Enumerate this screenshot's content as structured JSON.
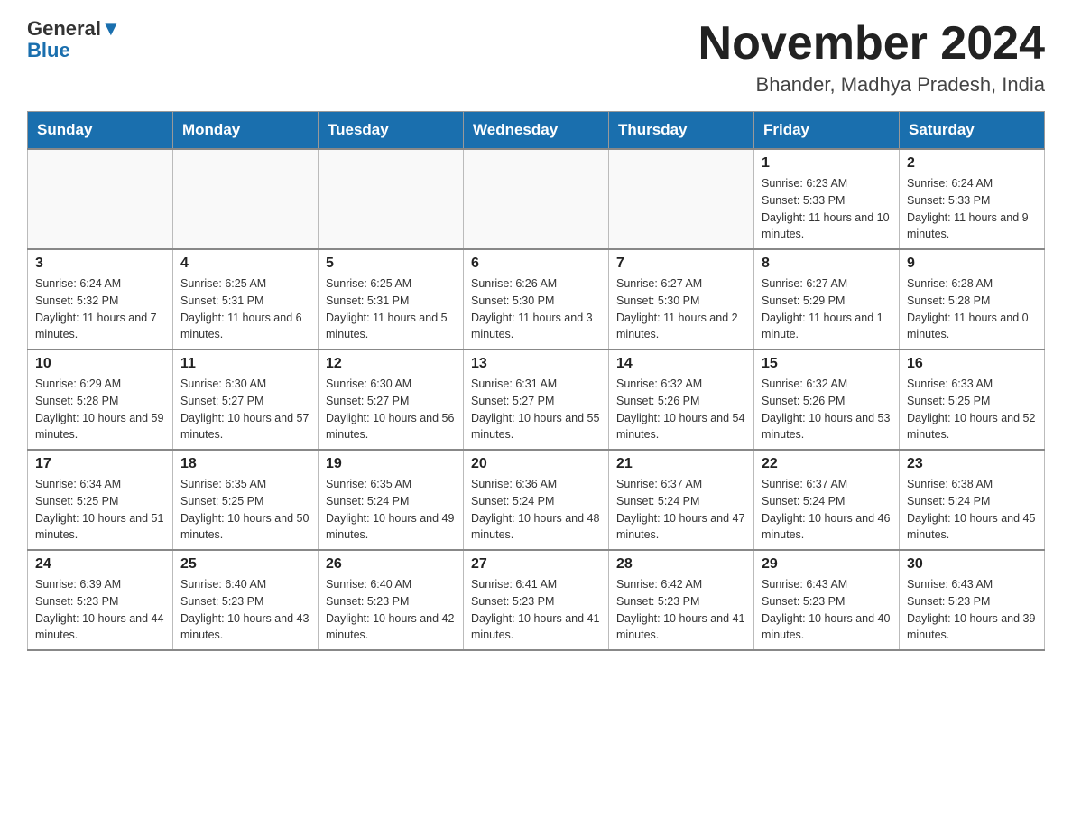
{
  "logo": {
    "text_general": "General",
    "text_blue": "Blue",
    "tagline": ""
  },
  "title": {
    "month_year": "November 2024",
    "location": "Bhander, Madhya Pradesh, India"
  },
  "days_of_week": [
    "Sunday",
    "Monday",
    "Tuesday",
    "Wednesday",
    "Thursday",
    "Friday",
    "Saturday"
  ],
  "weeks": [
    [
      {
        "day": "",
        "sunrise": "",
        "sunset": "",
        "daylight": ""
      },
      {
        "day": "",
        "sunrise": "",
        "sunset": "",
        "daylight": ""
      },
      {
        "day": "",
        "sunrise": "",
        "sunset": "",
        "daylight": ""
      },
      {
        "day": "",
        "sunrise": "",
        "sunset": "",
        "daylight": ""
      },
      {
        "day": "",
        "sunrise": "",
        "sunset": "",
        "daylight": ""
      },
      {
        "day": "1",
        "sunrise": "Sunrise: 6:23 AM",
        "sunset": "Sunset: 5:33 PM",
        "daylight": "Daylight: 11 hours and 10 minutes."
      },
      {
        "day": "2",
        "sunrise": "Sunrise: 6:24 AM",
        "sunset": "Sunset: 5:33 PM",
        "daylight": "Daylight: 11 hours and 9 minutes."
      }
    ],
    [
      {
        "day": "3",
        "sunrise": "Sunrise: 6:24 AM",
        "sunset": "Sunset: 5:32 PM",
        "daylight": "Daylight: 11 hours and 7 minutes."
      },
      {
        "day": "4",
        "sunrise": "Sunrise: 6:25 AM",
        "sunset": "Sunset: 5:31 PM",
        "daylight": "Daylight: 11 hours and 6 minutes."
      },
      {
        "day": "5",
        "sunrise": "Sunrise: 6:25 AM",
        "sunset": "Sunset: 5:31 PM",
        "daylight": "Daylight: 11 hours and 5 minutes."
      },
      {
        "day": "6",
        "sunrise": "Sunrise: 6:26 AM",
        "sunset": "Sunset: 5:30 PM",
        "daylight": "Daylight: 11 hours and 3 minutes."
      },
      {
        "day": "7",
        "sunrise": "Sunrise: 6:27 AM",
        "sunset": "Sunset: 5:30 PM",
        "daylight": "Daylight: 11 hours and 2 minutes."
      },
      {
        "day": "8",
        "sunrise": "Sunrise: 6:27 AM",
        "sunset": "Sunset: 5:29 PM",
        "daylight": "Daylight: 11 hours and 1 minute."
      },
      {
        "day": "9",
        "sunrise": "Sunrise: 6:28 AM",
        "sunset": "Sunset: 5:28 PM",
        "daylight": "Daylight: 11 hours and 0 minutes."
      }
    ],
    [
      {
        "day": "10",
        "sunrise": "Sunrise: 6:29 AM",
        "sunset": "Sunset: 5:28 PM",
        "daylight": "Daylight: 10 hours and 59 minutes."
      },
      {
        "day": "11",
        "sunrise": "Sunrise: 6:30 AM",
        "sunset": "Sunset: 5:27 PM",
        "daylight": "Daylight: 10 hours and 57 minutes."
      },
      {
        "day": "12",
        "sunrise": "Sunrise: 6:30 AM",
        "sunset": "Sunset: 5:27 PM",
        "daylight": "Daylight: 10 hours and 56 minutes."
      },
      {
        "day": "13",
        "sunrise": "Sunrise: 6:31 AM",
        "sunset": "Sunset: 5:27 PM",
        "daylight": "Daylight: 10 hours and 55 minutes."
      },
      {
        "day": "14",
        "sunrise": "Sunrise: 6:32 AM",
        "sunset": "Sunset: 5:26 PM",
        "daylight": "Daylight: 10 hours and 54 minutes."
      },
      {
        "day": "15",
        "sunrise": "Sunrise: 6:32 AM",
        "sunset": "Sunset: 5:26 PM",
        "daylight": "Daylight: 10 hours and 53 minutes."
      },
      {
        "day": "16",
        "sunrise": "Sunrise: 6:33 AM",
        "sunset": "Sunset: 5:25 PM",
        "daylight": "Daylight: 10 hours and 52 minutes."
      }
    ],
    [
      {
        "day": "17",
        "sunrise": "Sunrise: 6:34 AM",
        "sunset": "Sunset: 5:25 PM",
        "daylight": "Daylight: 10 hours and 51 minutes."
      },
      {
        "day": "18",
        "sunrise": "Sunrise: 6:35 AM",
        "sunset": "Sunset: 5:25 PM",
        "daylight": "Daylight: 10 hours and 50 minutes."
      },
      {
        "day": "19",
        "sunrise": "Sunrise: 6:35 AM",
        "sunset": "Sunset: 5:24 PM",
        "daylight": "Daylight: 10 hours and 49 minutes."
      },
      {
        "day": "20",
        "sunrise": "Sunrise: 6:36 AM",
        "sunset": "Sunset: 5:24 PM",
        "daylight": "Daylight: 10 hours and 48 minutes."
      },
      {
        "day": "21",
        "sunrise": "Sunrise: 6:37 AM",
        "sunset": "Sunset: 5:24 PM",
        "daylight": "Daylight: 10 hours and 47 minutes."
      },
      {
        "day": "22",
        "sunrise": "Sunrise: 6:37 AM",
        "sunset": "Sunset: 5:24 PM",
        "daylight": "Daylight: 10 hours and 46 minutes."
      },
      {
        "day": "23",
        "sunrise": "Sunrise: 6:38 AM",
        "sunset": "Sunset: 5:24 PM",
        "daylight": "Daylight: 10 hours and 45 minutes."
      }
    ],
    [
      {
        "day": "24",
        "sunrise": "Sunrise: 6:39 AM",
        "sunset": "Sunset: 5:23 PM",
        "daylight": "Daylight: 10 hours and 44 minutes."
      },
      {
        "day": "25",
        "sunrise": "Sunrise: 6:40 AM",
        "sunset": "Sunset: 5:23 PM",
        "daylight": "Daylight: 10 hours and 43 minutes."
      },
      {
        "day": "26",
        "sunrise": "Sunrise: 6:40 AM",
        "sunset": "Sunset: 5:23 PM",
        "daylight": "Daylight: 10 hours and 42 minutes."
      },
      {
        "day": "27",
        "sunrise": "Sunrise: 6:41 AM",
        "sunset": "Sunset: 5:23 PM",
        "daylight": "Daylight: 10 hours and 41 minutes."
      },
      {
        "day": "28",
        "sunrise": "Sunrise: 6:42 AM",
        "sunset": "Sunset: 5:23 PM",
        "daylight": "Daylight: 10 hours and 41 minutes."
      },
      {
        "day": "29",
        "sunrise": "Sunrise: 6:43 AM",
        "sunset": "Sunset: 5:23 PM",
        "daylight": "Daylight: 10 hours and 40 minutes."
      },
      {
        "day": "30",
        "sunrise": "Sunrise: 6:43 AM",
        "sunset": "Sunset: 5:23 PM",
        "daylight": "Daylight: 10 hours and 39 minutes."
      }
    ]
  ]
}
